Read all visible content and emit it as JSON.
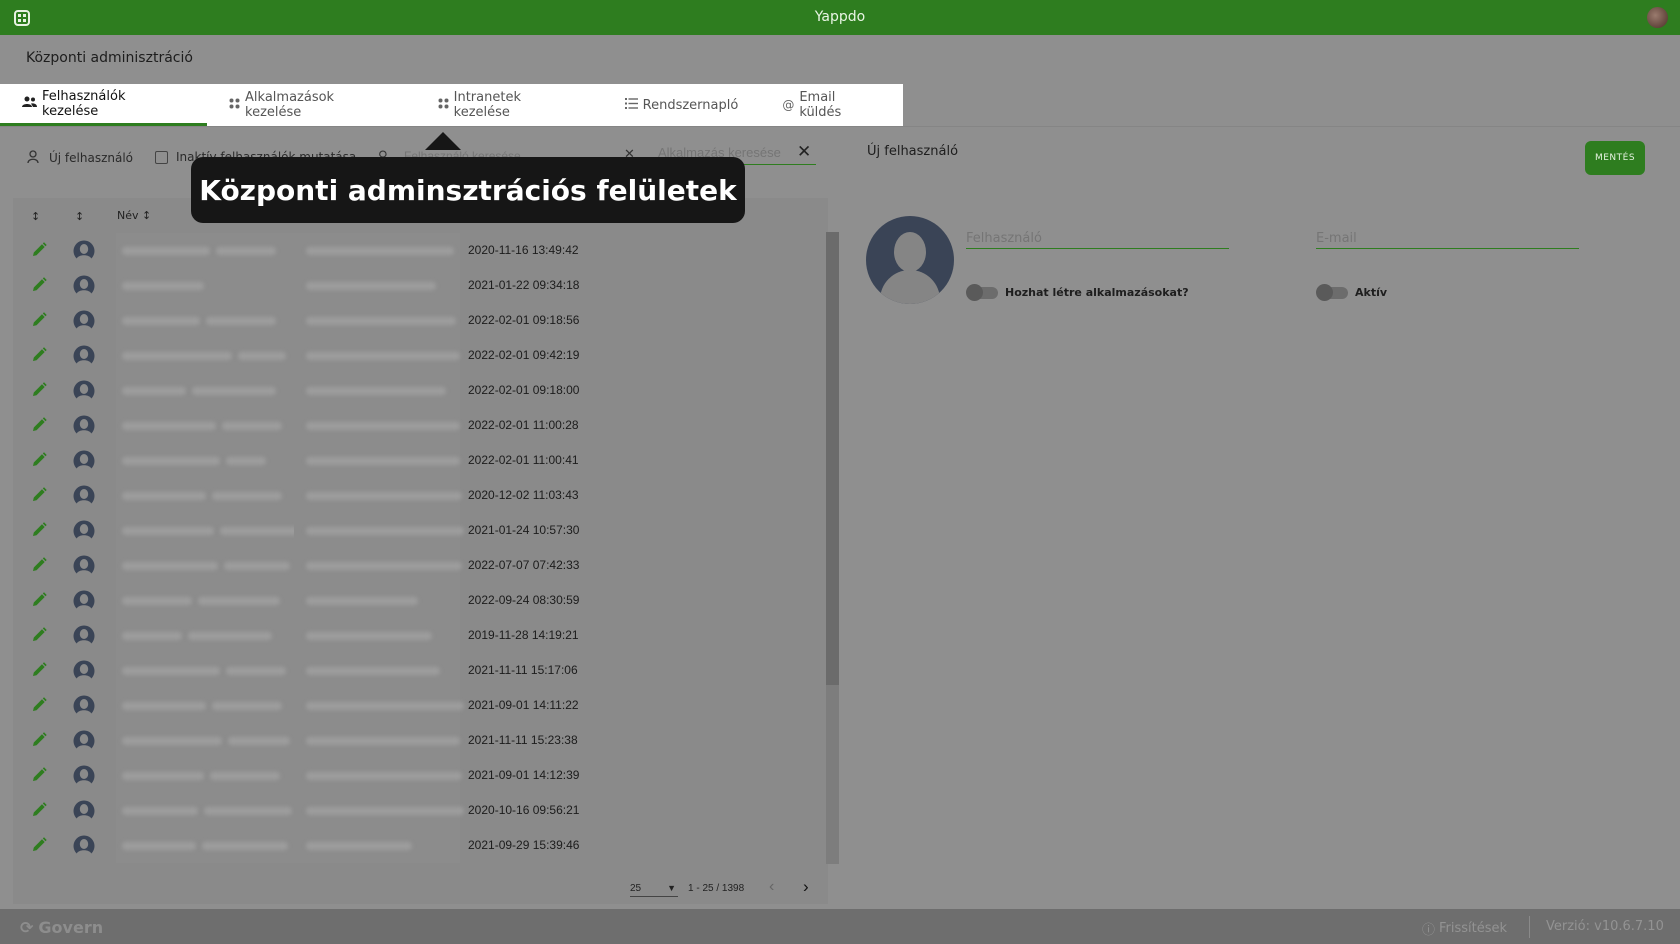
{
  "app": {
    "title": "Yappdo"
  },
  "page": {
    "title": "Központi adminisztráció"
  },
  "tabs": [
    {
      "label": "Felhasználók kezelése",
      "icon": "users-icon",
      "active": true
    },
    {
      "label": "Alkalmazások kezelése",
      "icon": "apps-icon",
      "active": false
    },
    {
      "label": "Intranetek kezelése",
      "icon": "apps-icon",
      "active": false
    },
    {
      "label": "Rendszernapló",
      "icon": "list-icon",
      "active": false
    },
    {
      "label": "Email küldés",
      "icon": "at-icon",
      "active": false
    }
  ],
  "toolbar": {
    "new_user_label": "Új felhasználó",
    "inactive_label": "Inaktív felhasználók mutatása",
    "user_search_placeholder": "Felhasználó keresése",
    "app_search_placeholder": "Alkalmazás keresése"
  },
  "table": {
    "name_header": "Név",
    "dates": [
      "2020-11-16 13:49:42",
      "2021-01-22 09:34:18",
      "2022-02-01 09:18:56",
      "2022-02-01 09:42:19",
      "2022-02-01 09:18:00",
      "2022-02-01 11:00:28",
      "2022-02-01 11:00:41",
      "2020-12-02 11:03:43",
      "2021-01-24 10:57:30",
      "2022-07-07 07:42:33",
      "2022-09-24 08:30:59",
      "2019-11-28 14:19:21",
      "2021-11-11 15:17:06",
      "2021-09-01 14:11:22",
      "2021-11-11 15:23:38",
      "2021-09-01 14:12:39",
      "2020-10-16 09:56:21",
      "2021-09-29 15:39:46"
    ]
  },
  "pager": {
    "page_size": "25",
    "range": "1 - 25 / 1398"
  },
  "detail": {
    "title": "Új felhasználó",
    "save_label": "MENTÉS",
    "username_placeholder": "Felhasználó",
    "email_placeholder": "E-mail",
    "toggle_create_apps_label": "Hozhat létre alkalmazásokat?",
    "toggle_active_label": "Aktív"
  },
  "tooltip": {
    "text": "Központi adminsztrációs felületek"
  },
  "footer": {
    "brand": "Govern",
    "updates_label": "Frissítések",
    "version": "Verzió: v10.6.7.10"
  },
  "colors": {
    "brand_green": "#2e7d1f",
    "tooltip_bg": "#161616"
  }
}
